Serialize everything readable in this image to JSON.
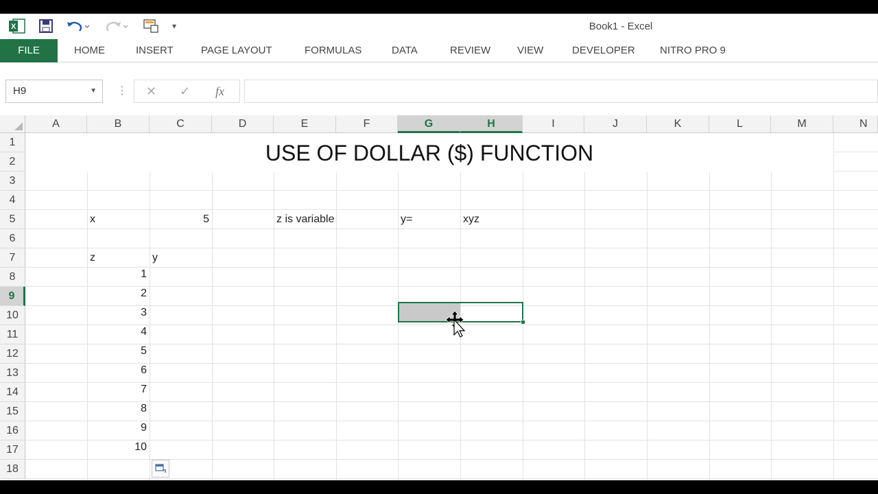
{
  "window": {
    "title": "Book1 - Excel"
  },
  "qat": {
    "icons": [
      "excel-icon",
      "save-icon",
      "undo-icon",
      "redo-icon",
      "touch-mode-icon",
      "customize-qat-icon"
    ]
  },
  "ribbon": {
    "tabs": [
      "FILE",
      "HOME",
      "INSERT",
      "PAGE LAYOUT",
      "FORMULAS",
      "DATA",
      "REVIEW",
      "VIEW",
      "DEVELOPER",
      "NITRO PRO 9"
    ]
  },
  "formula_bar": {
    "name_box": "H9",
    "fx_label": "fx",
    "cancel_label": "✕",
    "enter_label": "✓",
    "value": ""
  },
  "grid": {
    "columns": [
      "A",
      "B",
      "C",
      "D",
      "E",
      "F",
      "G",
      "H",
      "I",
      "J",
      "K",
      "L",
      "M",
      "N"
    ],
    "rows": [
      "1",
      "2",
      "3",
      "4",
      "5",
      "6",
      "7",
      "8",
      "9",
      "10",
      "11",
      "12",
      "13",
      "14",
      "15",
      "16",
      "17",
      "18"
    ],
    "selected_range": "G9:H9",
    "active_cell": "H9",
    "selected_columns": [
      "G",
      "H"
    ],
    "selected_row": "9"
  },
  "sheet": {
    "title": "USE OF DOLLAR ($) FUNCTION",
    "b4": "x",
    "c4": "5",
    "e4": "z is variable",
    "g4": "y=",
    "h4": "xyz",
    "b6": "z",
    "c6": "y",
    "z_values": [
      "1",
      "2",
      "3",
      "4",
      "5",
      "6",
      "7",
      "8",
      "9",
      "10"
    ]
  },
  "colors": {
    "accent": "#217346"
  }
}
